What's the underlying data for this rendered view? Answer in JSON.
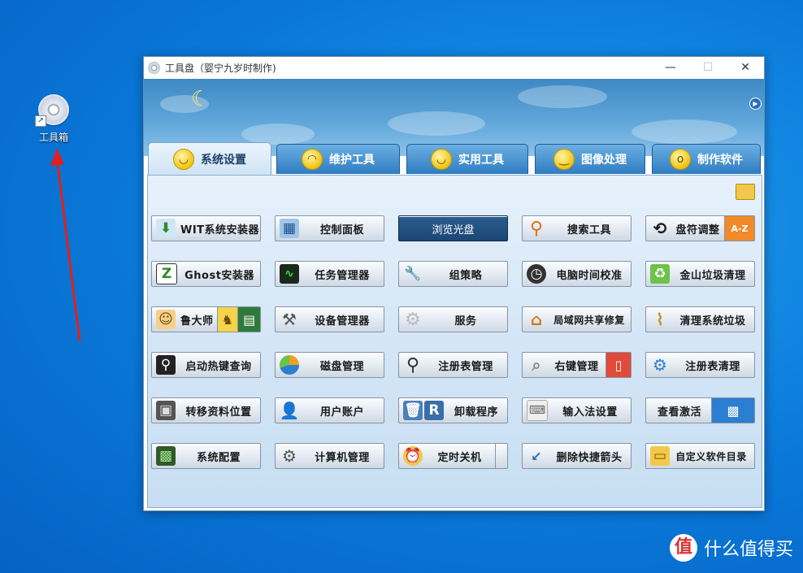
{
  "desktop": {
    "icon_label": "工具箱"
  },
  "window": {
    "title": "工具盘（婴宁九岁时制作)",
    "controls": {
      "minimize": "—",
      "maximize": "☐",
      "close": "✕"
    }
  },
  "tabs": [
    {
      "label": "系统设置",
      "face": "◡"
    },
    {
      "label": "维护工具",
      "face": "◠"
    },
    {
      "label": "实用工具",
      "face": "◡"
    },
    {
      "label": "图像处理",
      "face": "‿"
    },
    {
      "label": "制作软件",
      "face": "o"
    }
  ],
  "buttons": {
    "wit": "WIT系统安装器",
    "control_panel": "控制面板",
    "browse_disc": "浏览光盘",
    "search_tool": "搜索工具",
    "drive_letter": "盘符调整",
    "ghost": "Ghost安装器",
    "task_manager": "任务管理器",
    "group_policy": "组策略",
    "time_sync": "电脑时间校准",
    "kingsoft_clean": "金山垃圾清理",
    "ludashi": "鲁大师",
    "device_manager": "设备管理器",
    "services": "服务",
    "lan_share": "局域网共享修复",
    "clean_junk": "清理系统垃圾",
    "hotkey": "启动热键查询",
    "disk_mgmt": "磁盘管理",
    "regedit": "注册表管理",
    "context_menu": "右键管理",
    "reg_clean": "注册表清理",
    "move_folders": "转移资料位置",
    "user_accounts": "用户账户",
    "uninstall": "卸载程序",
    "ime_settings": "输入法设置",
    "check_activation": "查看激活",
    "sys_config": "系统配置",
    "computer_mgmt": "计算机管理",
    "shutdown_timer": "定时关机",
    "remove_arrow": "删除快捷箭头",
    "custom_dir": "自定义软件目录"
  },
  "watermark": {
    "logo": "值",
    "text": "什么值得买"
  },
  "colors": {
    "desktop": "#0a78d8",
    "tab": "#2f7cc2",
    "panel": "#d4e6f6",
    "dark_button": "#1c4674"
  }
}
